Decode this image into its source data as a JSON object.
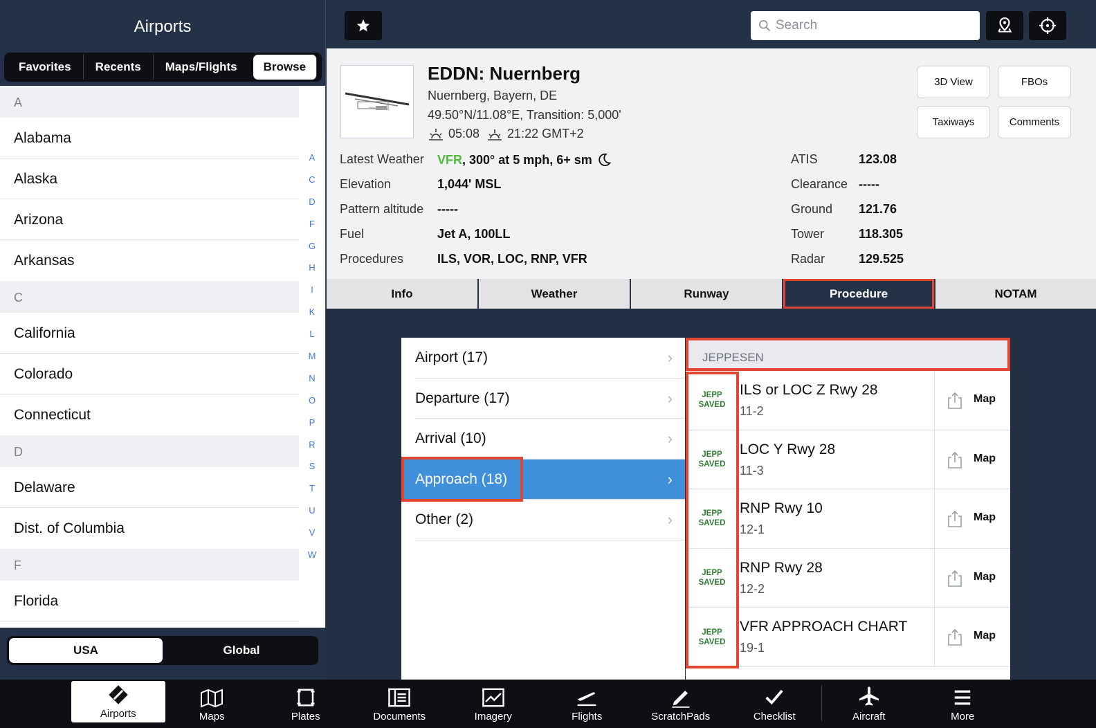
{
  "left": {
    "title": "Airports",
    "tabs": [
      "Favorites",
      "Recents",
      "Maps/Flights",
      "Browse"
    ],
    "active_tab": "Browse",
    "sections": [
      {
        "letter": "A",
        "items": [
          "Alabama",
          "Alaska",
          "Arizona",
          "Arkansas"
        ]
      },
      {
        "letter": "C",
        "items": [
          "California",
          "Colorado",
          "Connecticut"
        ]
      },
      {
        "letter": "D",
        "items": [
          "Delaware",
          "Dist. of Columbia"
        ]
      },
      {
        "letter": "F",
        "items": [
          "Florida"
        ]
      }
    ],
    "index": [
      "A",
      "C",
      "D",
      "F",
      "G",
      "H",
      "I",
      "K",
      "L",
      "M",
      "N",
      "O",
      "P",
      "R",
      "S",
      "T",
      "U",
      "V",
      "W"
    ],
    "region": {
      "usa": "USA",
      "global": "Global",
      "active": "USA"
    }
  },
  "topbar": {
    "search_placeholder": "Search"
  },
  "airport": {
    "name": "EDDN: Nuernberg",
    "city": "Nuernberg, Bayern, DE",
    "coords": "49.50°N/11.08°E, Transition: 5,000'",
    "sunrise": "05:08",
    "sunset": "21:22 GMT+2",
    "buttons": [
      "3D View",
      "FBOs",
      "Taxiways",
      "Comments"
    ],
    "left_fields": [
      {
        "label": "Latest Weather",
        "value_vfr": "VFR",
        "value": ", 300° at 5 mph, 6+ sm"
      },
      {
        "label": "Elevation",
        "value": "1,044' MSL"
      },
      {
        "label": "Pattern altitude",
        "value": "-----"
      },
      {
        "label": "Fuel",
        "value": "Jet A, 100LL"
      },
      {
        "label": "Procedures",
        "value": "ILS, VOR, LOC, RNP, VFR"
      }
    ],
    "right_fields": [
      {
        "label": "ATIS",
        "value": "123.08"
      },
      {
        "label": "Clearance",
        "value": "-----"
      },
      {
        "label": "Ground",
        "value": "121.76"
      },
      {
        "label": "Tower",
        "value": "118.305"
      },
      {
        "label": "Radar",
        "value": "129.525"
      }
    ]
  },
  "tabs": [
    "Info",
    "Weather",
    "Runway",
    "Procedure",
    "NOTAM"
  ],
  "active_tab": "Procedure",
  "categories": [
    "Airport (17)",
    "Departure (17)",
    "Arrival (10)",
    "Approach (18)",
    "Other (2)"
  ],
  "active_category": "Approach (18)",
  "procedures": {
    "header": "JEPPESEN",
    "saved_line1": "JEPP",
    "saved_line2": "SAVED",
    "map_label": "Map",
    "items": [
      {
        "name": "ILS or LOC Z Rwy 28",
        "number": "11-2"
      },
      {
        "name": "LOC Y Rwy 28",
        "number": "11-3"
      },
      {
        "name": "RNP Rwy 10",
        "number": "12-1"
      },
      {
        "name": "RNP Rwy 28",
        "number": "12-2"
      },
      {
        "name": "VFR APPROACH CHART",
        "number": "19-1"
      }
    ]
  },
  "bottom_nav": [
    "Airports",
    "Maps",
    "Plates",
    "Documents",
    "Imagery",
    "Flights",
    "ScratchPads",
    "Checklist",
    "Aircraft",
    "More"
  ],
  "bottom_active": "Airports",
  "colors": {
    "accent": "#3f8fdb",
    "highlight_box": "#e04632",
    "vfr": "#4cbb3a",
    "navy": "#243247"
  }
}
